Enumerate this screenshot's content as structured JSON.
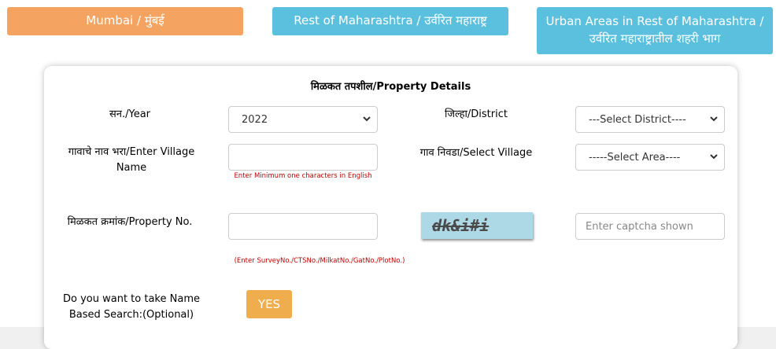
{
  "tabs": {
    "mumbai": "Mumbai / मुंबई",
    "rest": "Rest of Maharashtra / उर्वरित महाराष्ट्र",
    "urban": "Urban Areas in Rest of Maharashtra / उर्वरित महाराष्ट्रातील शहरी भाग"
  },
  "form": {
    "title": "मिळकत तपशील/Property Details",
    "year_label": "सन./Year",
    "year_value": "2022",
    "district_label": "जिल्हा/District",
    "district_value": "---Select District----",
    "village_name_label": "गावाचे नाव भरा/Enter Village Name",
    "village_name_value": "",
    "village_hint": "Enter Minimum one characters in English",
    "select_village_label": "गाव निवडा/Select Village",
    "select_village_value": "-----Select Area----",
    "property_no_label": "मिळकत क्रमांक/Property No.",
    "property_no_value": "",
    "property_hint": "(Enter SurveyNo./CTSNo./MilkatNo./GatNo./PlotNo.)",
    "captcha_text": "dk&i#i",
    "captcha_placeholder": "Enter captcha shown",
    "name_search_label": "Do you want to take Name Based Search:(Optional)",
    "yes_label": "YES"
  },
  "colors": {
    "mumbai_tab": "#f4a460",
    "other_tabs": "#5bc0de",
    "yes_button": "#f0ad4e",
    "captcha_bg": "#add8e6",
    "hint_text": "#c00000"
  }
}
